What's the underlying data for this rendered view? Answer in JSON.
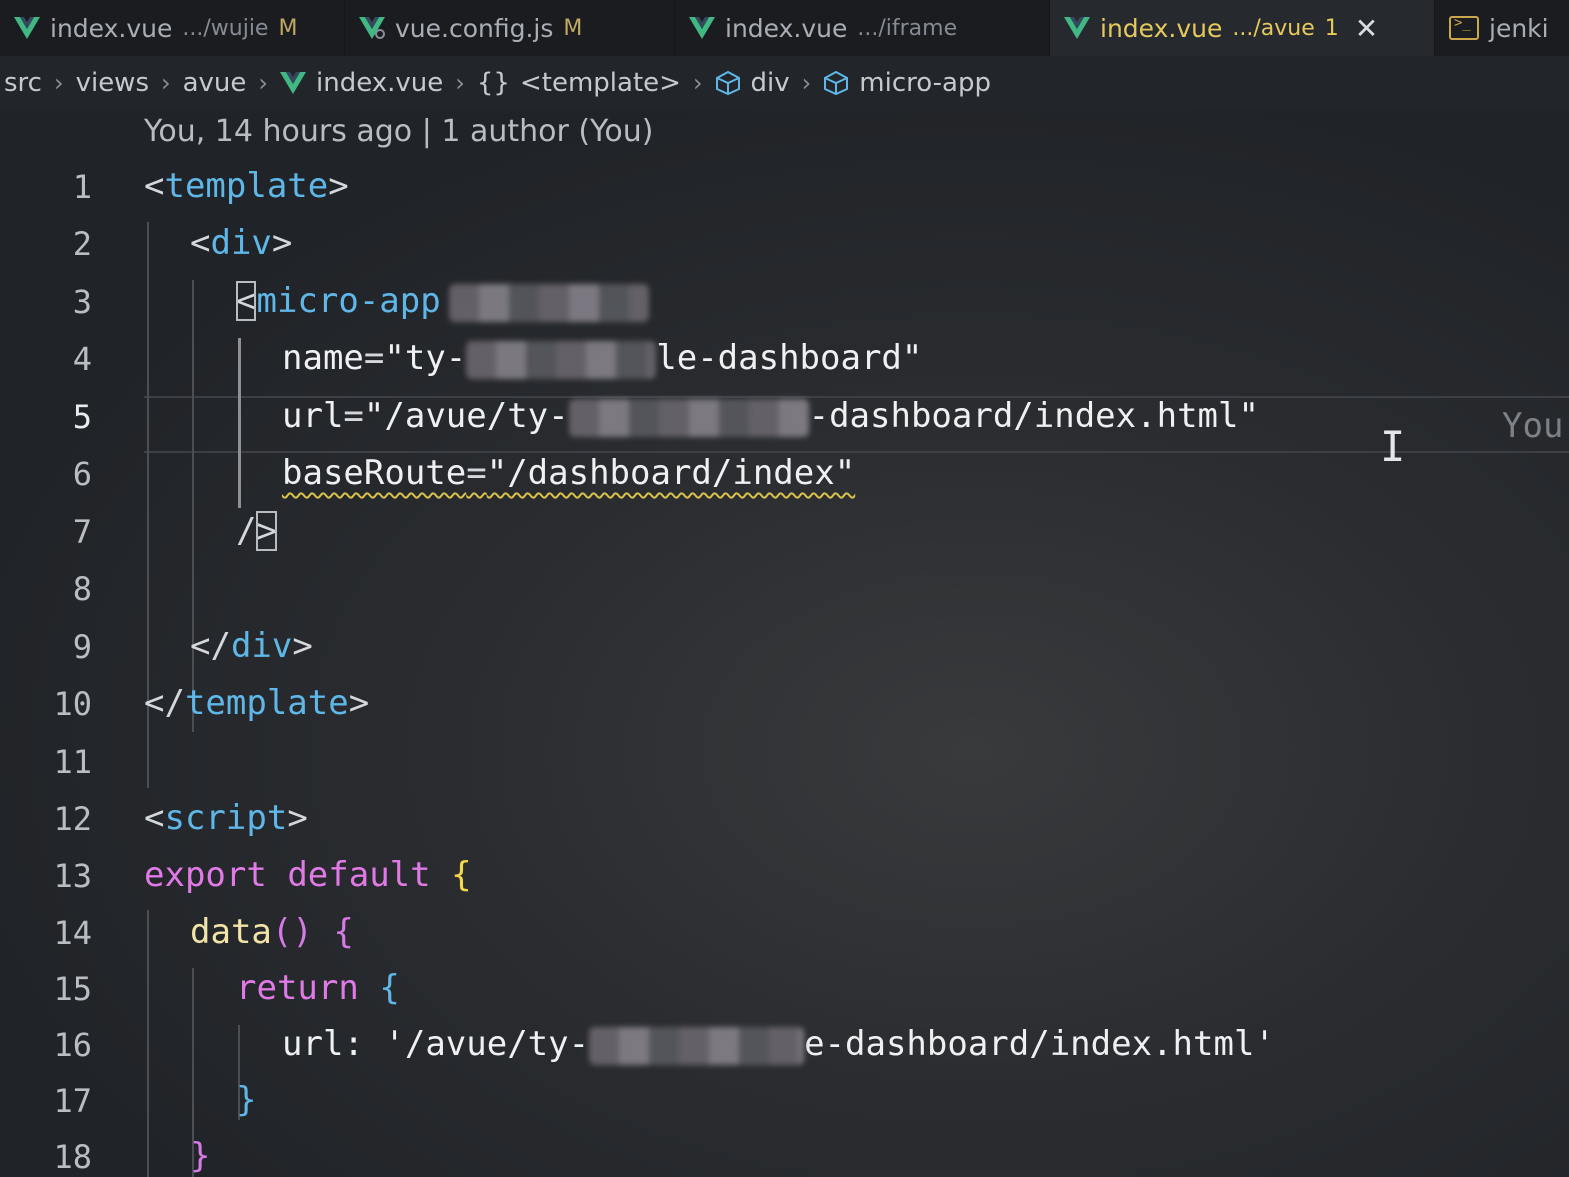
{
  "tabs": [
    {
      "name": "index.vue",
      "path": ".../wujie",
      "status": "M",
      "icon": "vue-icon",
      "active": false
    },
    {
      "name": "vue.config.js",
      "path": "",
      "status": "M",
      "icon": "vue-config-icon",
      "active": false
    },
    {
      "name": "index.vue",
      "path": ".../iframe",
      "status": "",
      "icon": "vue-icon",
      "active": false
    },
    {
      "name": "index.vue",
      "path": ".../avue",
      "status": "1",
      "icon": "vue-icon",
      "active": true,
      "close": "✕"
    },
    {
      "name": "jenki",
      "path": "",
      "status": "",
      "icon": "terminal-icon",
      "active": false
    }
  ],
  "breadcrumb": [
    "src",
    "views",
    "avue",
    "index.vue",
    "<template>",
    "div",
    "micro-app"
  ],
  "breadcrumb_icons": {
    "template": "{}"
  },
  "blame": "You, 14 hours ago | 1 author (You)",
  "ghost_blame": "You",
  "line_numbers": [
    "1",
    "2",
    "3",
    "4",
    "5",
    "6",
    "7",
    "8",
    "9",
    "10",
    "11",
    "12",
    "13",
    "14",
    "15",
    "16",
    "17",
    "18"
  ],
  "code": {
    "l1": {
      "open": "<",
      "tag": "template",
      "close": ">"
    },
    "l2": {
      "open": "<",
      "tag": "div",
      "close": ">"
    },
    "l3": {
      "open": "<",
      "tag": "micro-app"
    },
    "l4": {
      "attr": "name",
      "eq": "=",
      "str_start": "\"ty-",
      "str_end": "le-dashboard\""
    },
    "l5": {
      "attr": "url",
      "eq": "=",
      "str_start": "\"/avue/ty-",
      "str_end": "-dashboard/index.html\""
    },
    "l6": {
      "attr": "baseRoute",
      "eq": "=",
      "str": "\"/dashboard/index\""
    },
    "l7": {
      "slash": "/",
      "close": ">"
    },
    "l9": {
      "open": "</",
      "tag": "div",
      "close": ">"
    },
    "l10": {
      "open": "</",
      "tag": "template",
      "close": ">"
    },
    "l12": {
      "open": "<",
      "tag": "script",
      "close": ">"
    },
    "l13": {
      "kw1": "export",
      "kw2": "default",
      "brace": "{"
    },
    "l14": {
      "fn": "data",
      "parens": "()",
      "brace": "{"
    },
    "l15": {
      "kw": "return",
      "brace": "{"
    },
    "l16": {
      "prop": "url:",
      "str_start": "'/avue/ty-",
      "str_end": "e-dashboard/index.html'"
    },
    "l17": {
      "brace": "}"
    },
    "l18": {
      "brace": "}"
    }
  },
  "colors": {
    "tag": "#5fb7e8",
    "keyword": "#e07ae6",
    "active_tab": "#e6c95c",
    "squiggle": "#d8c24a"
  }
}
